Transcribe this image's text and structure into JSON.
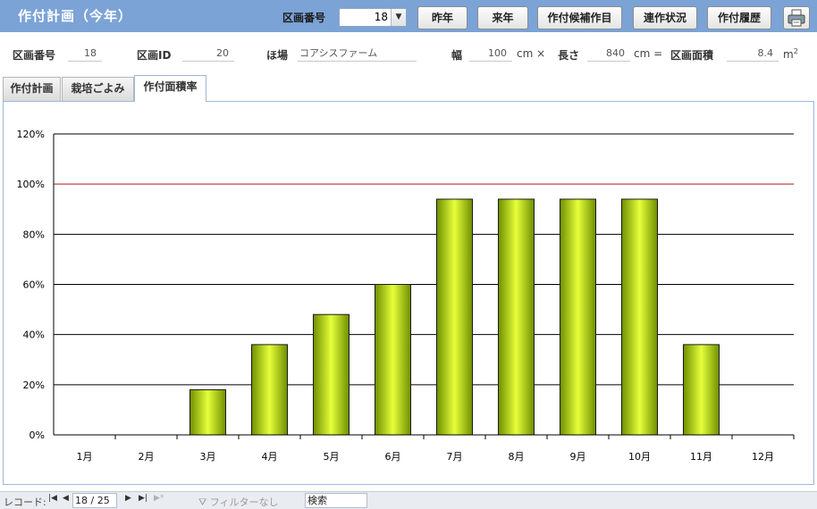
{
  "header": {
    "title": "作付計画（今年）",
    "plot_selector_label": "区画番号",
    "plot_selector_value": "18",
    "buttons": {
      "last_year": "昨年",
      "next_year": "来年",
      "candidate_crops": "作付候補作目",
      "rotation_status": "連作状況",
      "history": "作付履歴"
    },
    "print_icon": "printer-icon"
  },
  "info": {
    "plot_number_label": "区画番号",
    "plot_number": "18",
    "plot_id_label": "区画ID",
    "plot_id": "20",
    "field_label": "ほ場",
    "field_name": "コアシスファーム",
    "width_label": "幅",
    "width": "100",
    "width_unit": "cm ×",
    "length_label": "長さ",
    "length": "840",
    "length_unit": "cm =",
    "area_label": "区画面積",
    "area": "8.4",
    "area_unit": "m",
    "area_unit_sup": "2"
  },
  "tabs": [
    {
      "label": "作付計画",
      "active": false
    },
    {
      "label": "栽培ごよみ",
      "active": false
    },
    {
      "label": "作付面積率",
      "active": true
    }
  ],
  "chart_data": {
    "type": "bar",
    "categories": [
      "1月",
      "2月",
      "3月",
      "4月",
      "5月",
      "6月",
      "7月",
      "8月",
      "9月",
      "10月",
      "11月",
      "12月"
    ],
    "values": [
      0,
      0,
      18,
      36,
      48,
      60,
      94,
      94,
      94,
      94,
      36,
      0
    ],
    "ylim": [
      0,
      120
    ],
    "y_tick_labels": [
      "0%",
      "20%",
      "40%",
      "60%",
      "80%",
      "100%",
      "120%"
    ],
    "y_ticks": [
      0,
      20,
      40,
      60,
      80,
      100,
      120
    ],
    "reference_line": 100,
    "grid": true,
    "colors": {
      "bar_light": "#e6ff3a",
      "bar_dark": "#6f8f00",
      "bar_edge": "#1a1a1a",
      "grid": "#000000",
      "reference_line": "#e04848"
    }
  },
  "status_bar": {
    "record_label": "レコード:",
    "record_position": "18 / 25",
    "filter_text": "フィルターなし",
    "search_text": "検索"
  }
}
